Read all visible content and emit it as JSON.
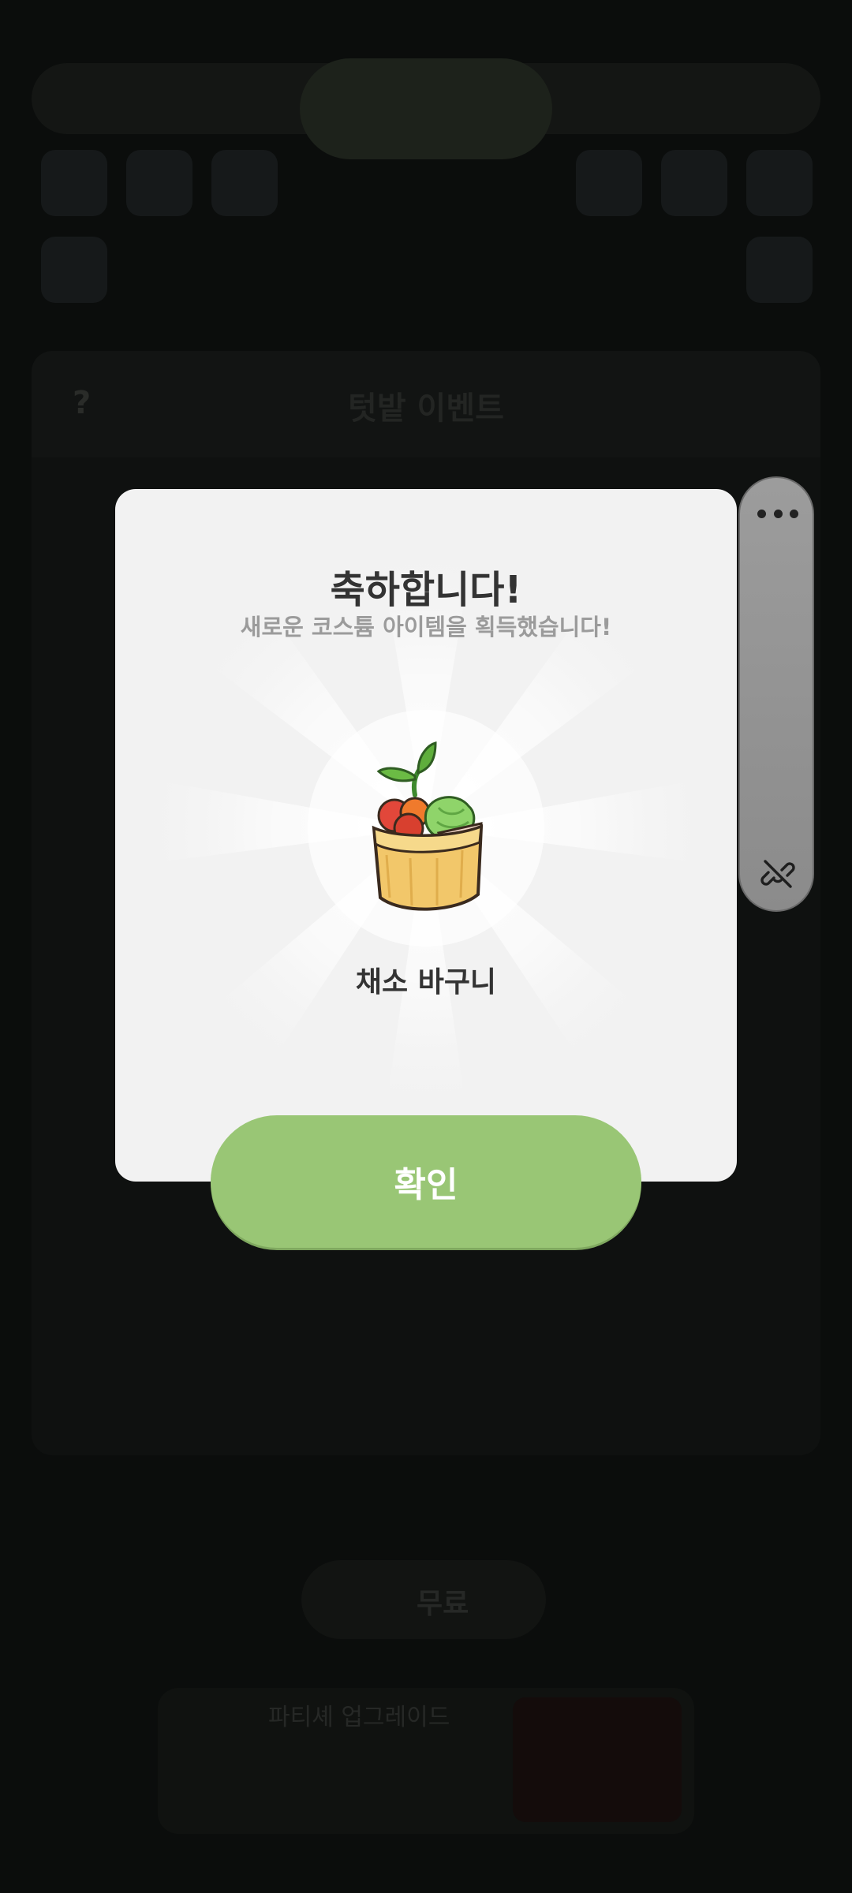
{
  "background": {
    "event_title": "텃밭 이벤트",
    "help_label": "?",
    "free_label": "무료",
    "bottom_card_title": "파티셰 업그레이드"
  },
  "modal": {
    "title": "축하합니다!",
    "subtitle": "새로운 코스튬 아이템을 획득했습니다!",
    "item_name": "채소 바구니",
    "item_icon": "vegetable-basket",
    "confirm_label": "확인"
  },
  "side_panel": {
    "more_icon": "more-horizontal",
    "bottom_icon": "link-off"
  },
  "colors": {
    "modal_bg": "#f2f2f2",
    "confirm_button": "#99c675",
    "title_text": "#333333",
    "subtitle_text": "#9b9b9b",
    "side_panel": "#8e8e8e"
  }
}
